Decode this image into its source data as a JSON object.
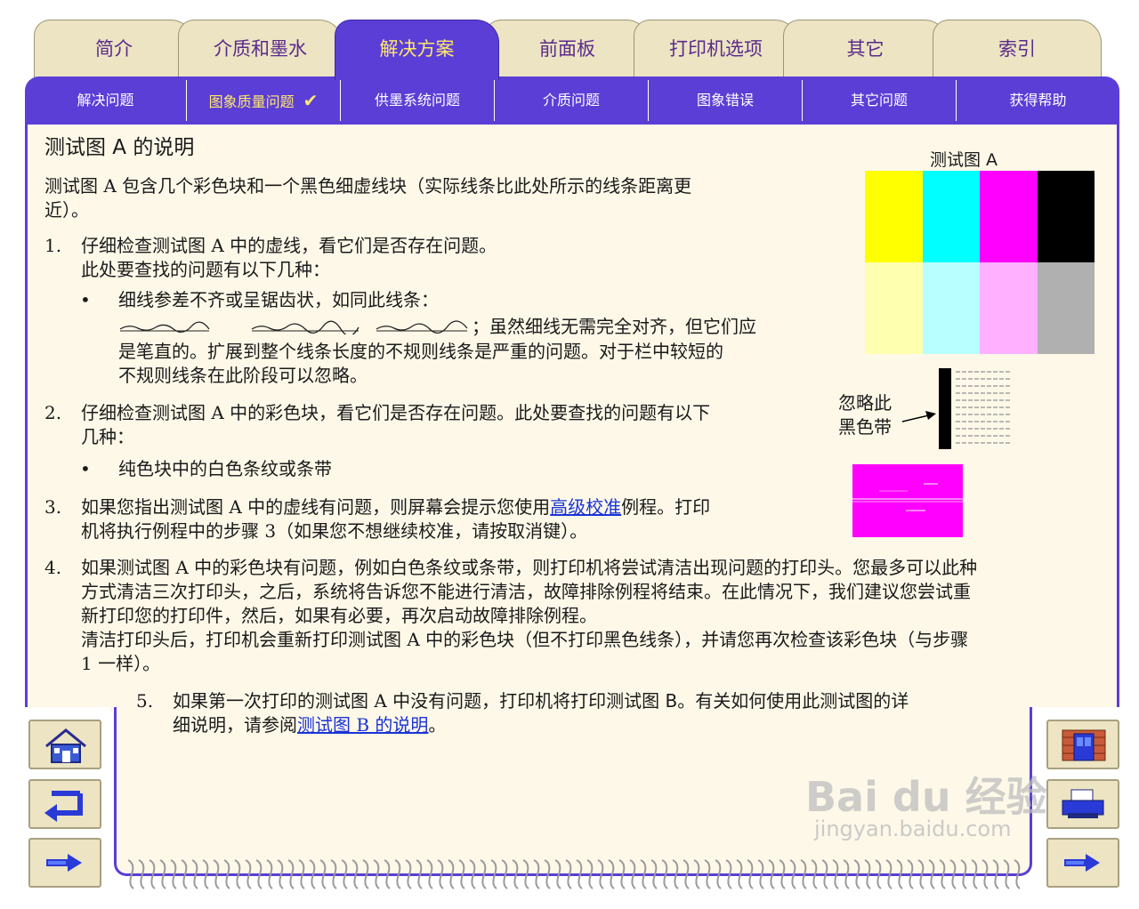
{
  "tabs": [
    {
      "label": "简介"
    },
    {
      "label": "介质和墨水"
    },
    {
      "label": "解决方案"
    },
    {
      "label": "前面板"
    },
    {
      "label": "打印机选项"
    },
    {
      "label": "其它"
    },
    {
      "label": "索引"
    }
  ],
  "subnav": [
    {
      "label": "解决问题"
    },
    {
      "label": "图象质量问题"
    },
    {
      "label": "供墨系统问题"
    },
    {
      "label": "介质问题"
    },
    {
      "label": "图象错误"
    },
    {
      "label": "其它问题"
    },
    {
      "label": "获得帮助"
    }
  ],
  "subnav_check": "✔",
  "content": {
    "title": "测试图 A 的说明",
    "intro_line1": "测试图 A 包含几个彩色块和一个黑色细虚线块（实际线条比此处所示的线条距离更",
    "intro_line2": "近）。",
    "s1_num": "1.",
    "s1_l1": "仔细检查测试图 A 中的虚线，看它们是否存在问题。",
    "s1_l2": "此处要查找的问题有以下几种：",
    "s1_bullet": "细线参差不齐或呈锯齿状，如同此线条：",
    "s1_wave_text": "；虽然细线无需完全对齐，但它们应",
    "s1_cont1": "是笔直的。扩展到整个线条长度的不规则线条是严重的问题。对于栏中较短的",
    "s1_cont2": "不规则线条在此阶段可以忽略。",
    "s2_num": "2.",
    "s2_l1": "仔细检查测试图 A 中的彩色块，看它们是否存在问题。此处要查找的问题有以下",
    "s2_l2": "几种：",
    "s2_bullet": "纯色块中的白色条纹或条带",
    "s3_num": "3.",
    "s3_l1_a": "如果您指出测试图 A 中的虚线有问题，则屏幕会提示您使用",
    "s3_link": "高级校准",
    "s3_l1_b": "例程。打印",
    "s3_l2_a": "机将执行例程中的步骤 3（如果您不想继续校准，请按",
    "s3_l2_bold": "取消",
    "s3_l2_b": "键）。",
    "s4_num": "4.",
    "s4_l1": "如果测试图 A 中的彩色块有问题，例如白色条纹或条带，则打印机将尝试清洁出现问题的打印头。您最多可以此种",
    "s4_l2_a": "方式清洁三次打印头，之后，系统将告诉您不能进行清洁，",
    "s4_l2_bold": "故障排除",
    "s4_l2_b": "例程将结束。在此情况下，我们建议您尝试重",
    "s4_l3_a": "新打印您的打印件，然后，如果有必要，再次启动",
    "s4_l3_bold": "故障排除",
    "s4_l3_b": "例程。",
    "s4_l4": "清洁打印头后，打印机会重新打印测试图 A 中的彩色块（但不打印黑色线条），并请您再次检查该彩色块（与步骤",
    "s4_l5": "1 一样）。",
    "s5_num": "5.",
    "s5_l1_a": "如果第一次打印的测试图 A 中没有问题，打印机将",
    "s5_l1_bold": "打印测试图 B",
    "s5_l1_b": "。有关如何使用此测试图的详",
    "s5_l2_a": "细说明，请参阅",
    "s5_link": "测试图 B 的说明",
    "s5_l2_b": "。"
  },
  "figure": {
    "label": "测试图 A",
    "swatches_top": [
      "#ffff00",
      "#00ffff",
      "#ff00ff",
      "#000000"
    ],
    "swatches_bottom": [
      "#ffffb0",
      "#b8ffff",
      "#ffb0ff",
      "#b0b0b0"
    ],
    "ignore_label_l1": "忽略此",
    "ignore_label_l2": "黑色带",
    "magenta": "#ff00ff"
  },
  "nav_icons": [
    "home-icon",
    "back-icon",
    "previous-icon",
    "door-icon",
    "printer-icon",
    "next-icon"
  ],
  "watermark": {
    "line1": "Bai du 经验",
    "line2": "jingyan.baidu.com"
  }
}
